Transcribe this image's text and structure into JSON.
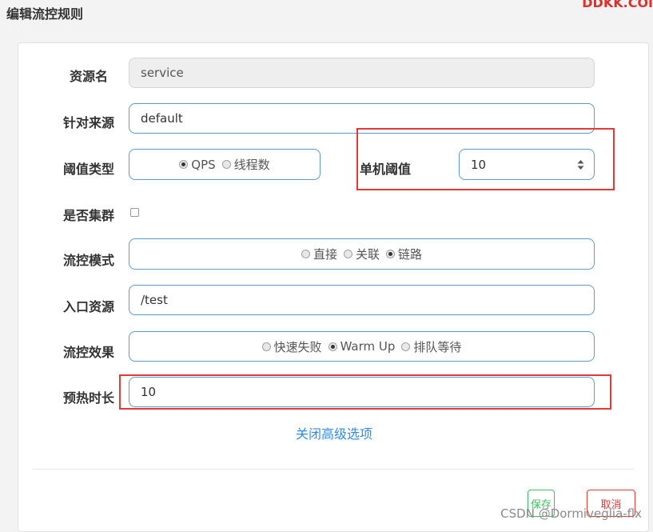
{
  "header": {
    "title": "编辑流控规则",
    "brand": "DDKK.COI"
  },
  "form": {
    "resource_name": {
      "label": "资源名",
      "value": "service"
    },
    "limit_app": {
      "label": "针对来源",
      "value": "default"
    },
    "grade": {
      "label": "阈值类型",
      "options": [
        "QPS",
        "线程数"
      ],
      "selected": "QPS"
    },
    "count": {
      "label": "单机阈值",
      "value": "10"
    },
    "cluster": {
      "label": "是否集群",
      "checked": false
    },
    "strategy": {
      "label": "流控模式",
      "options": [
        "直接",
        "关联",
        "链路"
      ],
      "selected": "链路"
    },
    "ref_resource": {
      "label": "入口资源",
      "value": "/test"
    },
    "control_behavior": {
      "label": "流控效果",
      "options": [
        "快速失败",
        "Warm Up",
        "排队等待"
      ],
      "selected": "Warm Up"
    },
    "warmup": {
      "label": "预热时长",
      "value": "10"
    }
  },
  "advanced_link": "关闭高级选项",
  "footer": {
    "save_label": "保存",
    "cancel_label": "取消"
  },
  "watermark": "CSDN @Dormiveglia-flx",
  "colors": {
    "accent": "#5b9bd5",
    "highlight": "#e53935",
    "save": "#3fbf5f",
    "link": "#2d8cf0"
  },
  "icons": [
    "radio-icon",
    "checkbox-icon",
    "spinner-icon"
  ]
}
